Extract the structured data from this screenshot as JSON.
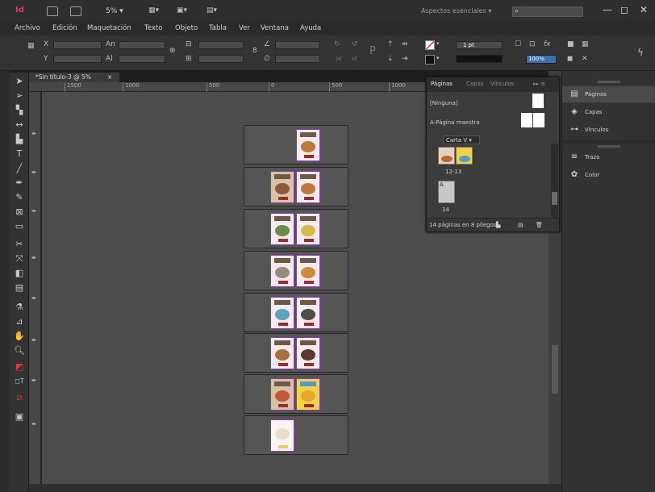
{
  "titlebar": {
    "logo": "Id",
    "zoom": "5%",
    "workspace": "Aspectos esenciales",
    "search_icon": "search-icon",
    "window_buttons": [
      "—",
      "◻",
      "✕"
    ]
  },
  "menu": [
    "Archivo",
    "Edición",
    "Maquetación",
    "Texto",
    "Objeto",
    "Tabla",
    "Ver",
    "Ventana",
    "Ayuda"
  ],
  "control": {
    "stroke_weight": "1 pt",
    "opacity": "100%"
  },
  "document": {
    "tab_title": "*Sin título-3 @ 5%",
    "tab_close": "×",
    "ruler_marks": [
      "1500",
      "1000",
      "500",
      "0",
      "500",
      "1000"
    ]
  },
  "pages_panel": {
    "tabs": [
      "Páginas",
      "Capas",
      "Vínculos"
    ],
    "none_label": "[Ninguna]",
    "master_label": "A-Página maestra",
    "dropdown": "Carta V",
    "spread_label": "12-13",
    "master_prefix": "A",
    "page_label": "14",
    "footer": "14 páginas en 8 pliegos"
  },
  "dock": {
    "items": [
      {
        "label": "Páginas",
        "icon": "pages-icon"
      },
      {
        "label": "Capas",
        "icon": "layers-icon"
      },
      {
        "label": "Vínculos",
        "icon": "links-icon"
      },
      {
        "label": "Trazo",
        "icon": "stroke-icon"
      },
      {
        "label": "Color",
        "icon": "color-icon"
      }
    ]
  },
  "spreads": [
    {
      "pages": 1
    },
    {
      "pages": 2
    },
    {
      "pages": 2
    },
    {
      "pages": 2
    },
    {
      "pages": 2
    },
    {
      "pages": 2
    },
    {
      "pages": 2
    },
    {
      "pages": 1
    }
  ]
}
